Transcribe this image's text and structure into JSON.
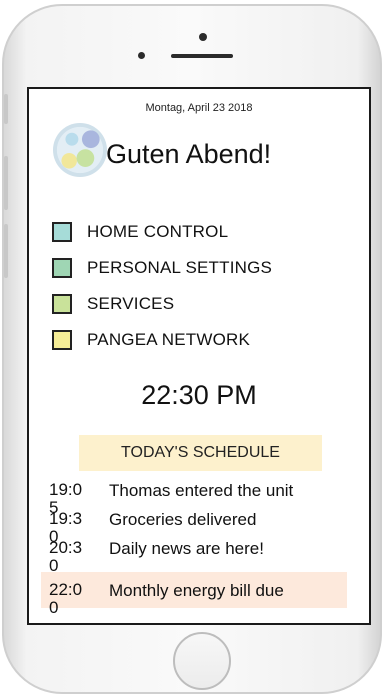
{
  "header": {
    "date": "Montag, April 23 2018",
    "greeting": "Guten Abend!"
  },
  "menu": {
    "items": [
      {
        "label": "HOME CONTROL",
        "color": "#a6dcd8"
      },
      {
        "label": "PERSONAL SETTINGS",
        "color": "#9fd6b4"
      },
      {
        "label": "SERVICES",
        "color": "#c9e29a"
      },
      {
        "label": "PANGEA NETWORK",
        "color": "#f6ee97"
      }
    ]
  },
  "clock": {
    "time": "22:30 PM"
  },
  "schedule": {
    "title": "TODAY'S SCHEDULE",
    "events": [
      {
        "time": "19:05",
        "text": "Thomas entered the unit"
      },
      {
        "time": "19:30",
        "text": "Groceries delivered"
      },
      {
        "time": "20:30",
        "text": "Daily news are here!"
      },
      {
        "time": "22:00",
        "text": "Monthly energy bill due"
      }
    ]
  },
  "colors": {
    "schedule_title_bg": "#fdf1cd",
    "highlight_row_bg": "#fde9dc"
  }
}
